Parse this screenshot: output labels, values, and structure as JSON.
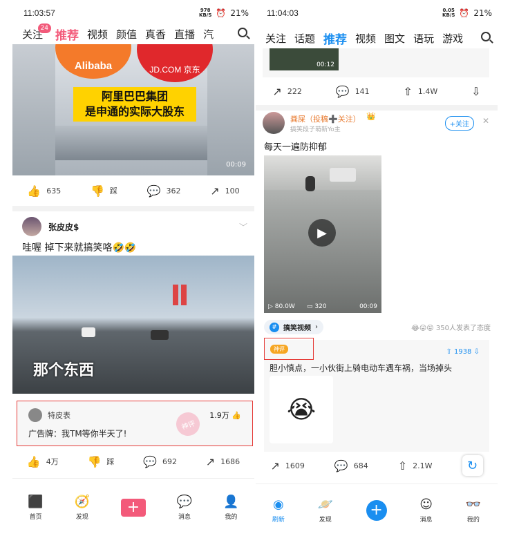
{
  "left": {
    "status": {
      "time": "11:03:57",
      "speed_top": "978",
      "speed_unit": "KB/S",
      "battery": "21%"
    },
    "tabs": [
      "关注",
      "推荐",
      "视频",
      "颜值",
      "真香",
      "直播",
      "汽"
    ],
    "follow_badge": "24",
    "video1": {
      "logo1": "Alibaba",
      "logo2": "JD.COM 京东",
      "headline1": "阿里巴巴集团",
      "headline2": "是申通的实际大股东",
      "duration": "00:09"
    },
    "actions1": {
      "likes": "635",
      "dislike": "踩",
      "comments": "362",
      "shares": "100"
    },
    "post2": {
      "author": "张皮皮$",
      "text": "哇喔   掉下来就搞笑咯🤣🤣",
      "video_caption": "那个东西"
    },
    "comment": {
      "author": "特皮表",
      "likes": "1.9万",
      "text": "广告牌：我TM等你半天了!",
      "stamp": "神评"
    },
    "actions2": {
      "likes": "4万",
      "dislike": "踩",
      "comments": "692",
      "shares": "1686"
    },
    "nav": [
      "首页",
      "发现",
      "消息",
      "我的"
    ]
  },
  "right": {
    "status": {
      "time": "11:04:03",
      "speed_top": "0.05",
      "speed_unit": "KB/S",
      "battery": "21%"
    },
    "tabs": [
      "关注",
      "话题",
      "推荐",
      "视频",
      "图文",
      "语玩",
      "游戏"
    ],
    "prev_video_duration": "00:12",
    "actions0": {
      "shares": "222",
      "comments": "141",
      "up": "1.4W"
    },
    "post": {
      "author": "粪屎（投稿➕关注）",
      "subtitle": "搞笑段子萌新Yo主",
      "follow": "+关注",
      "text": "每天一遍防抑郁",
      "plays": "80.0W",
      "danmaku": "320",
      "duration": "00:09"
    },
    "topic": {
      "name": "搞笑视频",
      "reactions": "350人发表了态度"
    },
    "god_comment": {
      "label": "神评",
      "ups": "1938",
      "text": "胆小慎点，一小伙街上骑电动车遇车祸，当场掉头"
    },
    "actions1": {
      "shares": "1609",
      "comments": "684",
      "up": "2.1W"
    },
    "nav": [
      "刷新",
      "发现",
      "消息",
      "我的"
    ]
  },
  "colors": {
    "pink": "#f35a7a",
    "blue": "#1a8ef0",
    "red_box": "#e53935"
  }
}
